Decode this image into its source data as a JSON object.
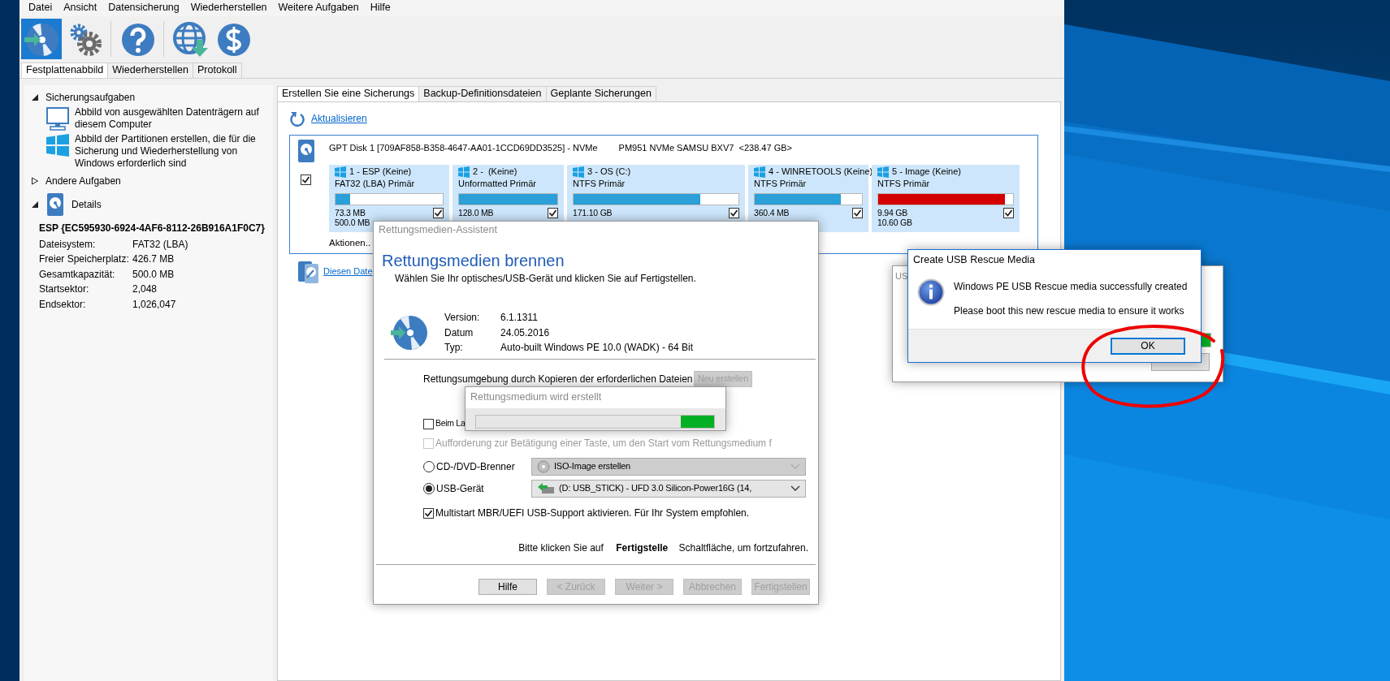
{
  "menu": [
    "Datei",
    "Ansicht",
    "Datensicherung",
    "Wiederherstellen",
    "Weitere Aufgaben",
    "Hilfe"
  ],
  "toolbar": [
    {
      "selected": true
    },
    {
      "selected": false
    },
    {
      "selected": false
    },
    {
      "selected": false
    },
    {
      "selected": false
    }
  ],
  "tabs": [
    {
      "label": "Festplattenabbild",
      "selected": true
    },
    {
      "label": "Wiederherstellen",
      "selected": false
    },
    {
      "label": "Protokoll",
      "selected": false
    }
  ],
  "sidebar": {
    "sections": [
      {
        "title": "Sicherungsaufgaben",
        "expanded": true,
        "kind": "tasks",
        "items": [
          "Abbild von ausgewählten Datenträgern auf diesem Computer",
          "Abbild der Partitionen erstellen, die für die Sicherung und Wiederherstellung von Windows erforderlich sind"
        ]
      },
      {
        "title": "Andere Aufgaben",
        "expanded": false,
        "kind": "plain"
      },
      {
        "title": "Details",
        "expanded": true,
        "kind": "details",
        "heading": "ESP {EC595930-6924-4AF6-8112-26B916A1F0C7}",
        "rows": [
          {
            "label": "Dateisystem:",
            "value": "FAT32 (LBA)"
          },
          {
            "label": "Freier Speicherplatz:",
            "value": "426.7 MB"
          },
          {
            "label": "Gesamtkapazität:",
            "value": "500.0 MB"
          },
          {
            "label": "Startsektor:",
            "value": "2,048"
          },
          {
            "label": "Endsektor:",
            "value": "1,026,047"
          }
        ]
      }
    ]
  },
  "content_tabs": [
    {
      "label": "Erstellen Sie eine Sicherungs",
      "selected": true
    },
    {
      "label": "Backup-Definitionsdateien",
      "selected": false
    },
    {
      "label": "Geplante Sicherungen",
      "selected": false
    }
  ],
  "refresh_link": "Aktualisieren",
  "disk": {
    "title": "GPT Disk 1 [709AF858-B358-4647-AA01-1CCD69DD3525] - NVMe",
    "model": "PM951 NVMe SAMSU BXV7  <238.47 GB>",
    "checked": true,
    "actions": "Aktionen..",
    "partitions": [
      {
        "name": "1 - ESP (Keine)",
        "type": "FAT32 (LBA) Primär",
        "level": 0.14,
        "color": "#2a9fd8",
        "used": "73.3 MB",
        "total": "500.0 MB",
        "checked": true
      },
      {
        "name": "2 -  (Keine)",
        "type": "Unformatted Primär",
        "level": 1,
        "color": "#2a9fd8",
        "used": "128.0 MB",
        "checked": true
      },
      {
        "name": "3 - OS (C:)",
        "type": "NTFS Primär",
        "level": 0.77,
        "color": "#2a9fd8",
        "used": "171.10 GB",
        "checked": true
      },
      {
        "name": "4 - WINRETOOLS (Keine)",
        "type": "NTFS Primär",
        "level": 0.8,
        "color": "#2a9fd8",
        "used": "360.4 MB",
        "checked": true
      },
      {
        "name": "5 - Image (Keine)",
        "type": "NTFS Primär",
        "level": 0.94,
        "color": "#d40000",
        "used": "9.94 GB",
        "total": "10.60 GB",
        "checked": true
      }
    ]
  },
  "restore_link": "Diesen Date",
  "wizard": {
    "title": "Rettungsmedien-Assistent",
    "heading": "Rettungsmedien brennen",
    "subtitle": "Wählen Sie Ihr optisches/USB-Gerät und klicken Sie auf Fertigstellen.",
    "info": [
      {
        "label": "Version:",
        "value": "6.1.1311"
      },
      {
        "label": "Datum",
        "value": "24.05.2016"
      },
      {
        "label": "Typ:",
        "value": "Auto-built Windows PE 10.0 (WADK) - 64 Bit"
      }
    ],
    "rebuild_text": "Rettungsumgebung durch Kopieren der erforderlichen Dateien",
    "rebuild_button": {
      "label": "Neu erstellen",
      "disabled": true
    },
    "options": [
      {
        "kind": "checkbox",
        "label": "Beim La",
        "checked": false,
        "disabled": false
      },
      {
        "kind": "checkbox",
        "label": "Aufforderung zur Betätigung einer Taste, um den Start vom Rettungsmedium f",
        "checked": false,
        "disabled": true
      },
      {
        "kind": "radio",
        "label": "CD-/DVD-Brenner",
        "selected": false,
        "combo": {
          "value": "ISO-Image erstellen",
          "disabled": true
        }
      },
      {
        "kind": "radio",
        "label": "USB-Gerät",
        "selected": true,
        "combo": {
          "value": "(D: USB_STICK) - UFD 3.0 Silicon-Power16G (14,",
          "disabled": false
        }
      },
      {
        "kind": "checkbox",
        "label": "Multistart MBR/UEFI USB-Support aktivieren. Für Ihr System empfohlen.",
        "checked": true,
        "disabled": false
      }
    ],
    "hint": "Bitte klicken Sie auf **Fertigstelle** Schaltfläche, um fortzufahren.",
    "buttons": [
      {
        "label": "Hilfe",
        "disabled": false
      },
      {
        "label": "< Zurück",
        "disabled": true
      },
      {
        "label": "Weiter >",
        "disabled": true
      },
      {
        "label": "Abbrechen",
        "disabled": true
      },
      {
        "label": "Fertigstellen",
        "disabled": true
      }
    ]
  },
  "progress_popup": {
    "title": "Rettungsmedium wird erstellt",
    "level": 0.14
  },
  "back_dialog": {
    "title": "US",
    "level": 1
  },
  "message_box": {
    "title": "Create USB Rescue Media",
    "lines": [
      "Windows PE USB Rescue media successfully created",
      "Please boot this new rescue media to ensure it works"
    ],
    "button": {
      "label": "OK",
      "focused": true
    }
  }
}
